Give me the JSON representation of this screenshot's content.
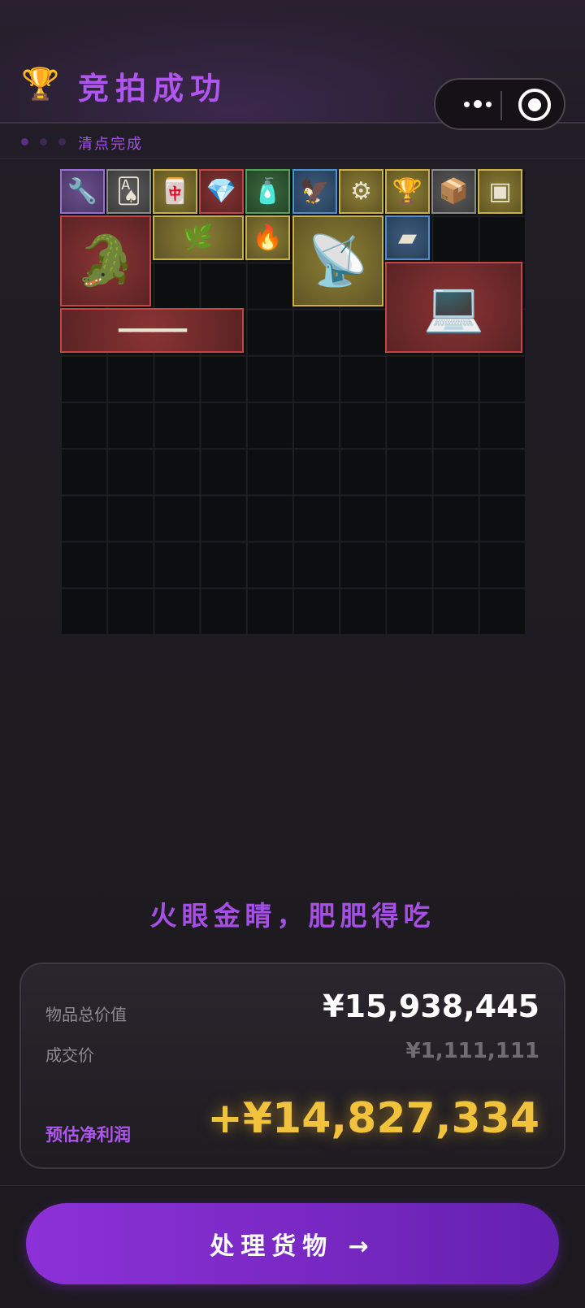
{
  "header": {
    "trophy_icon": "trophy-icon",
    "title": "竞拍成功",
    "capsule": {
      "more_icon": "more-dots-icon",
      "close_icon": "target-close-icon"
    }
  },
  "status": {
    "dot_colors": [
      "#5b2e82",
      "#3d2a52",
      "#3d2a52"
    ],
    "text": "清点完成"
  },
  "inventory": {
    "grid_columns": 10,
    "grid_rows": 10,
    "items": [
      {
        "name": "gun-part-item",
        "rarity": "purple",
        "icon": "🔧"
      },
      {
        "name": "playing-card-item",
        "rarity": "gray",
        "icon": "🂡"
      },
      {
        "name": "mahjong-cube-item",
        "rarity": "gold",
        "icon": "🀄"
      },
      {
        "name": "diamond-item",
        "rarity": "red",
        "icon": "💎"
      },
      {
        "name": "bottle-item",
        "rarity": "green",
        "icon": "🧴"
      },
      {
        "name": "bird-statue-item",
        "rarity": "blue",
        "icon": "🦅"
      },
      {
        "name": "cutter-tool-item",
        "rarity": "gold",
        "icon": "⚙"
      },
      {
        "name": "jeweled-goblet-item",
        "rarity": "gold",
        "icon": "🏆"
      },
      {
        "name": "cardboard-box-item",
        "rarity": "gray",
        "icon": "📦"
      },
      {
        "name": "cpu-chip-item",
        "rarity": "gold",
        "icon": "▣"
      },
      {
        "name": "golden-crocodile-statue-item",
        "rarity": "red",
        "icon": "🐊"
      },
      {
        "name": "laurel-crown-item",
        "rarity": "gold",
        "icon": "🌿"
      },
      {
        "name": "lighter-item",
        "rarity": "gold",
        "icon": "🔥"
      },
      {
        "name": "radar-dish-item",
        "rarity": "gold",
        "icon": "📡"
      },
      {
        "name": "silver-bar-item",
        "rarity": "blue",
        "icon": "▰"
      },
      {
        "name": "field-laptop-item",
        "rarity": "red",
        "icon": "💻"
      },
      {
        "name": "antique-musket-item",
        "rarity": "red",
        "icon": "═"
      }
    ]
  },
  "slogan": "火眼金睛，肥肥得吃",
  "summary": {
    "total_label": "物品总价值",
    "total_value": "¥15,938,445",
    "deal_label": "成交价",
    "deal_value": "¥1,111,111",
    "profit_label": "预估净利润",
    "profit_value": "+¥14,827,334"
  },
  "action": {
    "label": "处理货物 →"
  },
  "colors": {
    "accent_purple": "#b055ef",
    "profit_gold": "#f1c33c",
    "button_gradient_start": "#8c31d8",
    "button_gradient_end": "#6420b0"
  }
}
